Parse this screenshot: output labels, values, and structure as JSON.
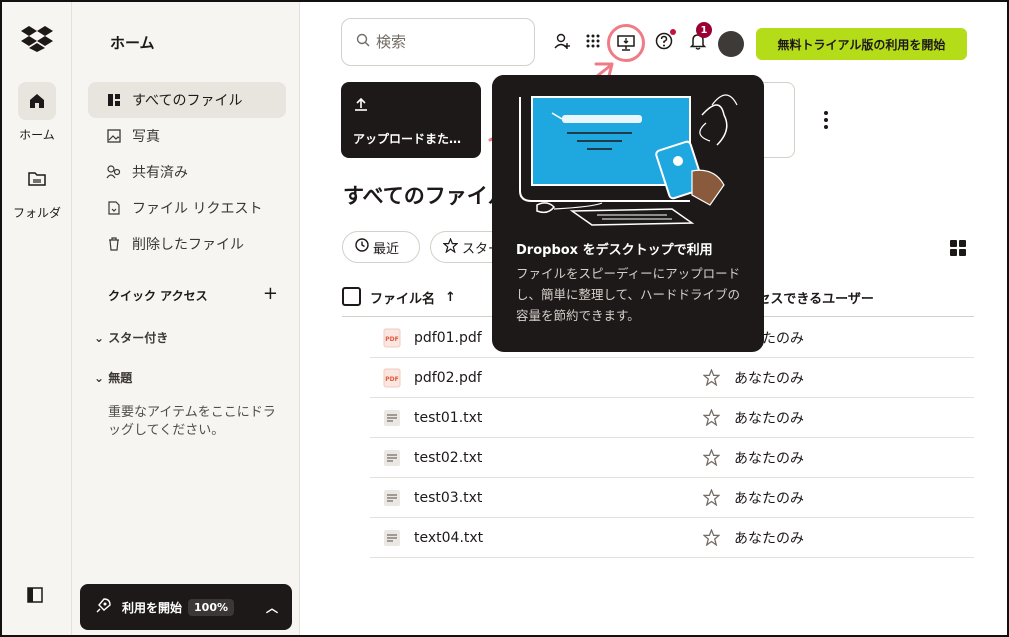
{
  "rail": {
    "items": [
      {
        "label": "ホーム",
        "icon": "home-icon"
      },
      {
        "label": "フォルダ",
        "icon": "folder-icon"
      }
    ]
  },
  "sidebar": {
    "title": "ホーム",
    "nav": [
      {
        "label": "すべてのファイル",
        "icon": "all-files-icon"
      },
      {
        "label": "写真",
        "icon": "photo-icon"
      },
      {
        "label": "共有済み",
        "icon": "shared-icon"
      },
      {
        "label": "ファイル リクエスト",
        "icon": "file-request-icon"
      },
      {
        "label": "削除したファイル",
        "icon": "trash-icon"
      }
    ],
    "quick_access": "クイック アクセス",
    "groups": [
      "スター付き",
      "無題"
    ],
    "hint": "重要なアイテムをここにドラッグしてください。",
    "start": {
      "label": "利用を開始",
      "percent": "100%"
    }
  },
  "topbar": {
    "search_placeholder": "検索",
    "notification_count": "1",
    "trial_label": "無料トライアル版の利用を開始"
  },
  "upload": {
    "label": "アップロードまた…"
  },
  "page_title": "すべてのファイル",
  "filters": {
    "recent": "最近",
    "starred": "スター付き"
  },
  "table": {
    "col_name": "ファイル名",
    "col_access": "アクセスできるユーザー",
    "rows": [
      {
        "name": "pdf01.pdf",
        "type": "pdf",
        "access": "あなたのみ"
      },
      {
        "name": "pdf02.pdf",
        "type": "pdf",
        "access": "あなたのみ"
      },
      {
        "name": "test01.txt",
        "type": "txt",
        "access": "あなたのみ"
      },
      {
        "name": "test02.txt",
        "type": "txt",
        "access": "あなたのみ"
      },
      {
        "name": "test03.txt",
        "type": "txt",
        "access": "あなたのみ"
      },
      {
        "name": "text04.txt",
        "type": "txt",
        "access": "あなたのみ"
      }
    ]
  },
  "popup": {
    "title": "Dropbox をデスクトップで利用",
    "description": "ファイルをスピーディーにアップロードし、簡単に整理して、ハードドライブの容量を節約できます。"
  },
  "colors": {
    "accent": "#b4dc19",
    "dark": "#1e1919",
    "highlight": "#f07b86",
    "badge": "#9b0032"
  }
}
